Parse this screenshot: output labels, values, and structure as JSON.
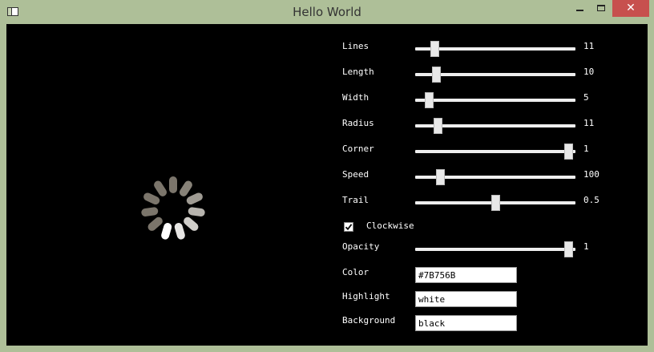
{
  "window": {
    "title": "Hello World",
    "close_glyph": "✕"
  },
  "icons": {
    "app": "window-icon",
    "close": "close-icon",
    "check": "checkmark-icon"
  },
  "colors": {
    "titlebar": "#aebf98",
    "close": "#c7504e",
    "canvas": "#000000"
  },
  "spinner": {
    "lines": 11,
    "color": "#7B756B",
    "highlight": "white"
  },
  "controls": {
    "lines": {
      "label": "Lines",
      "value": "11",
      "fraction": 0.1
    },
    "length": {
      "label": "Length",
      "value": "10",
      "fraction": 0.11
    },
    "width": {
      "label": "Width",
      "value": "5",
      "fraction": 0.065
    },
    "radius": {
      "label": "Radius",
      "value": "11",
      "fraction": 0.12
    },
    "corner": {
      "label": "Corner",
      "value": "1",
      "fraction": 0.985
    },
    "speed": {
      "label": "Speed",
      "value": "100",
      "fraction": 0.135
    },
    "trail": {
      "label": "Trail",
      "value": "0.5",
      "fraction": 0.5
    },
    "clockwise": {
      "label": "Clockwise",
      "checked": true
    },
    "opacity": {
      "label": "Opacity",
      "value": "1",
      "fraction": 0.985
    },
    "color": {
      "label": "Color",
      "value": "#7B756B"
    },
    "highlight": {
      "label": "Highlight",
      "value": "white"
    },
    "background": {
      "label": "Background",
      "value": "black"
    }
  }
}
